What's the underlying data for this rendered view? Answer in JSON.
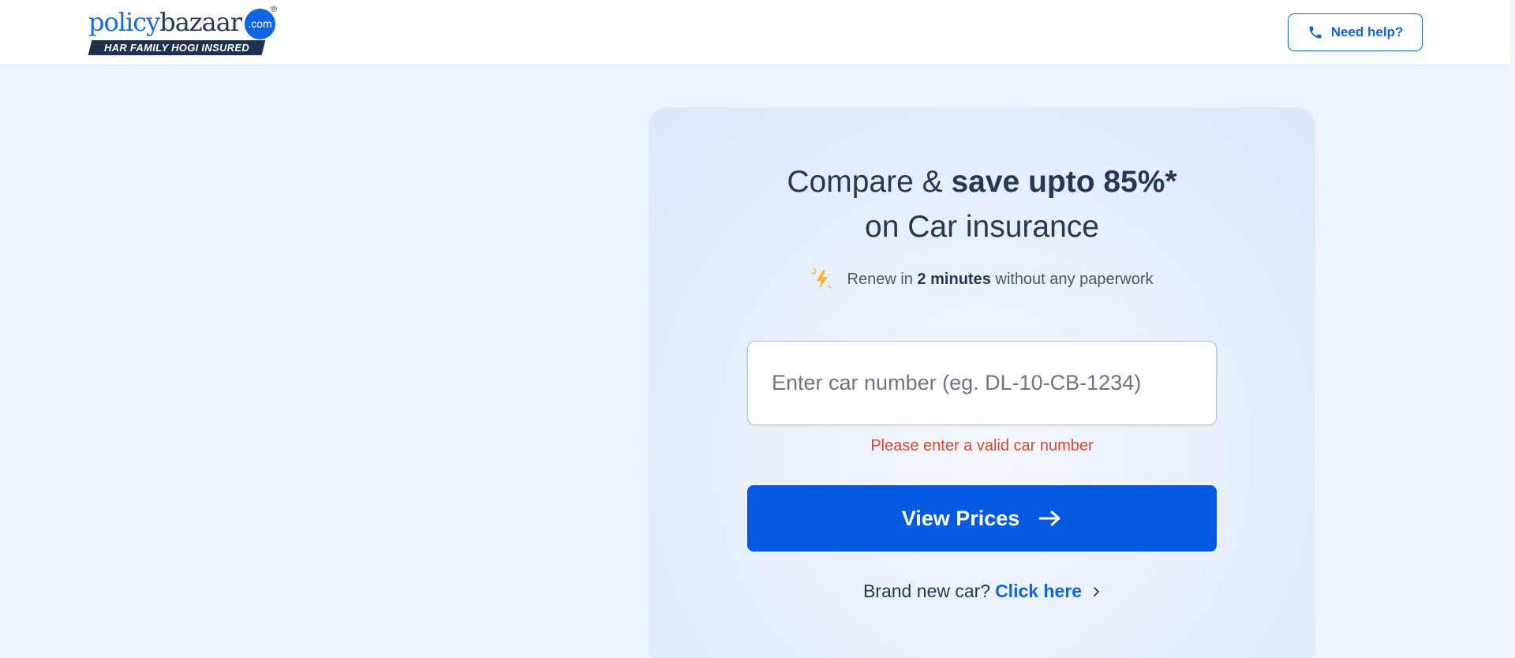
{
  "header": {
    "logo": {
      "word_part1": "policy",
      "word_part2": "bazaar",
      "com": ".com",
      "registered": "®",
      "tagline": "HAR FAMILY HOGI INSURED"
    },
    "help_button": {
      "label": "Need help?",
      "icon": "phone-icon"
    }
  },
  "card": {
    "headline": {
      "pre": "Compare & ",
      "bold": "save upto 85%*",
      "line2": "on Car insurance"
    },
    "subline": {
      "icon": "lightning-icon",
      "pre": "Renew in ",
      "bold": "2 minutes",
      "post": " without any paperwork"
    },
    "car_number_input": {
      "value": "",
      "placeholder": "Enter car number (eg. DL-10-CB-1234)"
    },
    "error_message": "Please enter a valid car number",
    "view_prices_button": {
      "label": "View Prices",
      "icon": "arrow-right-icon"
    },
    "brand_new_car": {
      "text": "Brand new car? ",
      "link": "Click here",
      "icon": "chevron-right-icon"
    }
  },
  "colors": {
    "brand_blue": "#0f65e6",
    "button_blue": "#0359e0",
    "navy": "#253858",
    "error": "#e2462d",
    "page_bg": "#eef4fd"
  }
}
